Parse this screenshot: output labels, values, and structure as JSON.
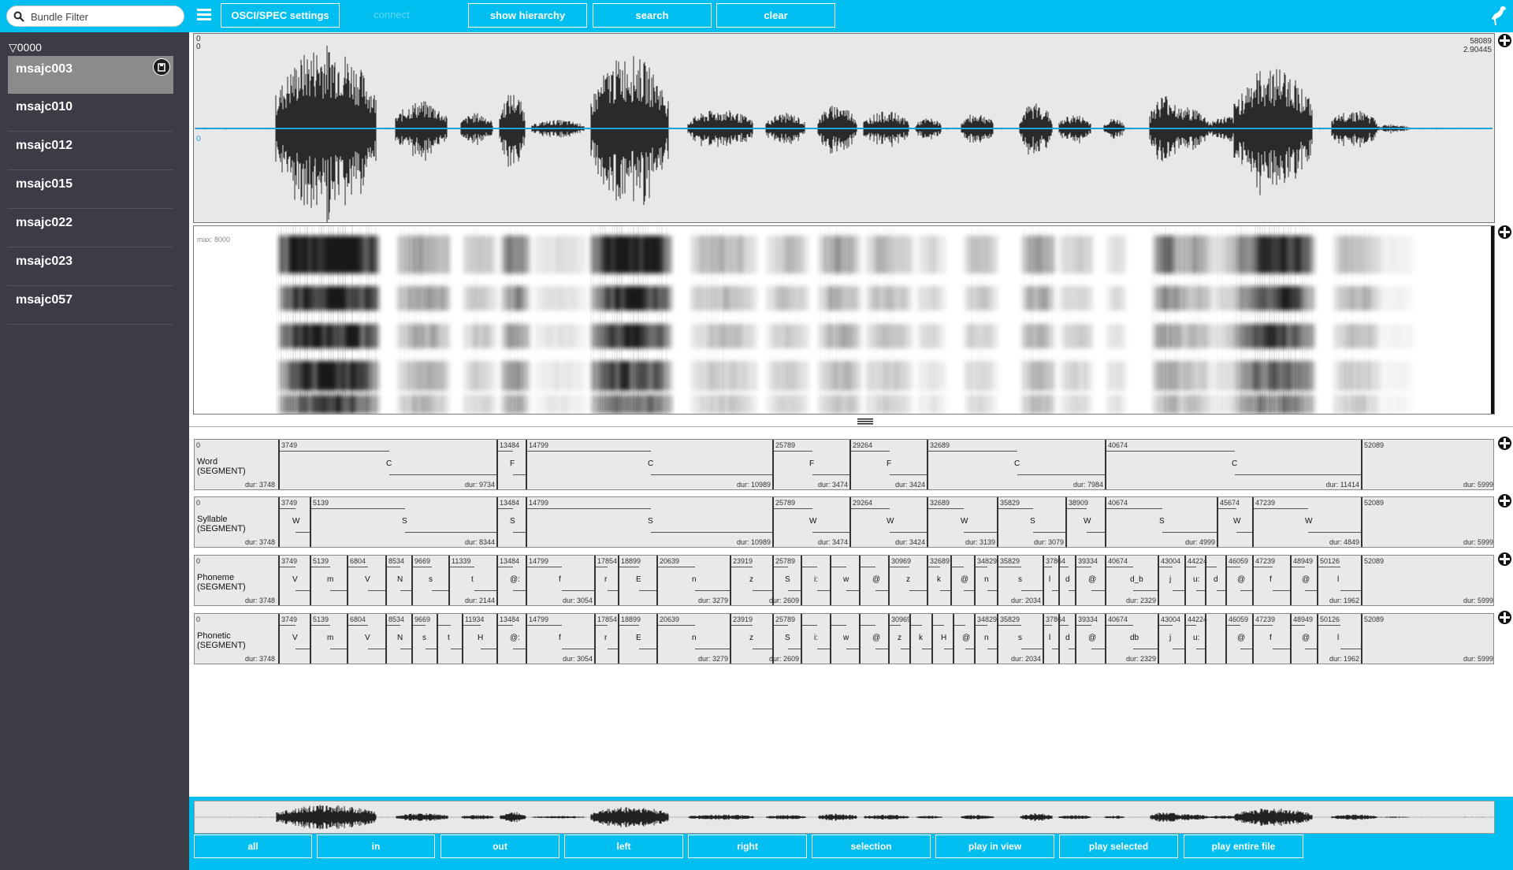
{
  "filter": {
    "placeholder": "Bundle Filter"
  },
  "session": {
    "label": "▽0000"
  },
  "bundles": [
    "msajc003",
    "msajc010",
    "msajc012",
    "msajc015",
    "msajc022",
    "msajc023",
    "msajc057"
  ],
  "toolbar": {
    "osci_settings": "OSCI/SPEC settings",
    "connect": "connect",
    "show_hierarchy": "show hierarchy",
    "search": "search",
    "clear": "clear"
  },
  "osci": {
    "start_top": "0",
    "start_bottom": "0",
    "zero_marker": "0",
    "end_samples": "58089",
    "end_seconds": "2.90445"
  },
  "spec": {
    "max_label": "max: 8000"
  },
  "colors": {
    "accent": "#00bff0",
    "sidebar": "#3b3c46",
    "waveform": "#2a2a2a",
    "zero_line": "#1fa3e0"
  },
  "icons": {
    "menu": "hamburger-icon",
    "filter": "search-icon",
    "logo": "emu-bird-icon",
    "save": "save-disk-icon",
    "resize": "resize-handle-icon"
  },
  "tiers": [
    {
      "name": "Word",
      "type": "(SEGMENT)",
      "start0": "0",
      "dur0": "dur: 3748",
      "segs": [
        {
          "s": "3749",
          "l": "C",
          "d": "dur: 9734"
        },
        {
          "s": "13484",
          "l": "F",
          "d": ""
        },
        {
          "s": "14799",
          "l": "C",
          "d": "dur: 10989"
        },
        {
          "s": "25789",
          "l": "F",
          "d": "dur: 3474"
        },
        {
          "s": "29264",
          "l": "F",
          "d": "dur: 3424"
        },
        {
          "s": "32689",
          "l": "C",
          "d": "dur: 7984"
        },
        {
          "s": "40674",
          "l": "C",
          "d": "dur: 11414"
        },
        {
          "s": "52089",
          "l": "",
          "d": "dur: 5999"
        }
      ]
    },
    {
      "name": "Syllable",
      "type": "(SEGMENT)",
      "start0": "0",
      "dur0": "dur: 3748",
      "segs": [
        {
          "s": "3749",
          "l": "W",
          "d": ""
        },
        {
          "s": "5139",
          "l": "S",
          "d": "dur: 8344"
        },
        {
          "s": "13484",
          "l": "S",
          "d": ""
        },
        {
          "s": "14799",
          "l": "S",
          "d": "dur: 10989"
        },
        {
          "s": "25789",
          "l": "W",
          "d": "dur: 3474"
        },
        {
          "s": "29264",
          "l": "W",
          "d": "dur: 3424"
        },
        {
          "s": "32689",
          "l": "W",
          "d": "dur: 3139"
        },
        {
          "s": "35829",
          "l": "S",
          "d": "dur: 3079"
        },
        {
          "s": "38909",
          "l": "W",
          "d": ""
        },
        {
          "s": "40674",
          "l": "S",
          "d": "dur: 4999"
        },
        {
          "s": "45674",
          "l": "W",
          "d": ""
        },
        {
          "s": "47239",
          "l": "W",
          "d": "dur: 4849"
        },
        {
          "s": "52089",
          "l": "",
          "d": "dur: 5999"
        }
      ]
    },
    {
      "name": "Phoneme",
      "type": "(SEGMENT)",
      "start0": "0",
      "dur0": "dur: 3748",
      "segs": [
        {
          "s": "3749",
          "l": "V",
          "d": ""
        },
        {
          "s": "5139",
          "l": "m",
          "d": ""
        },
        {
          "s": "6804",
          "l": "V",
          "d": ""
        },
        {
          "s": "8534",
          "l": "N",
          "d": ""
        },
        {
          "s": "9669",
          "l": "s",
          "d": ""
        },
        {
          "s": "11339",
          "l": "t",
          "d": "dur: 2144"
        },
        {
          "s": "13484",
          "l": "@:",
          "d": ""
        },
        {
          "s": "14799",
          "l": "f",
          "d": "dur: 3054"
        },
        {
          "s": "17854",
          "l": "r",
          "d": ""
        },
        {
          "s": "18899",
          "l": "E",
          "d": ""
        },
        {
          "s": "20639",
          "l": "n",
          "d": "dur: 3279"
        },
        {
          "s": "23919",
          "l": "z",
          "d": ""
        },
        {
          "s": "25789",
          "l": "S",
          "d": "dur: 2609"
        },
        {
          "s": "",
          "l": "i:",
          "d": ""
        },
        {
          "s": "",
          "l": "w",
          "d": ""
        },
        {
          "s": "",
          "l": "@",
          "d": ""
        },
        {
          "s": "30969",
          "l": "z",
          "d": ""
        },
        {
          "s": "32689",
          "l": "k",
          "d": ""
        },
        {
          "s": "",
          "l": "@",
          "d": ""
        },
        {
          "s": "34829",
          "l": "n",
          "d": ""
        },
        {
          "s": "35829",
          "l": "s",
          "d": "dur: 2034"
        },
        {
          "s": "37864",
          "l": "l",
          "d": ""
        },
        {
          "s": "",
          "l": "d",
          "d": ""
        },
        {
          "s": "39334",
          "l": "@",
          "d": ""
        },
        {
          "s": "40674",
          "l": "d_b",
          "d": "dur: 2329"
        },
        {
          "s": "43004",
          "l": "j",
          "d": ""
        },
        {
          "s": "44224",
          "l": "u:",
          "d": ""
        },
        {
          "s": "",
          "l": "d",
          "d": ""
        },
        {
          "s": "46059",
          "l": "@",
          "d": ""
        },
        {
          "s": "47239",
          "l": "f",
          "d": ""
        },
        {
          "s": "48949",
          "l": "@",
          "d": ""
        },
        {
          "s": "50126",
          "l": "l",
          "d": "dur: 1962"
        },
        {
          "s": "52089",
          "l": "",
          "d": "dur: 5999"
        }
      ]
    },
    {
      "name": "Phonetic",
      "type": "(SEGMENT)",
      "start0": "0",
      "dur0": "dur: 3748",
      "segs": [
        {
          "s": "3749",
          "l": "V",
          "d": ""
        },
        {
          "s": "5139",
          "l": "m",
          "d": ""
        },
        {
          "s": "6804",
          "l": "V",
          "d": ""
        },
        {
          "s": "8534",
          "l": "N",
          "d": ""
        },
        {
          "s": "9669",
          "l": "s",
          "d": ""
        },
        {
          "s": "",
          "l": "t",
          "d": ""
        },
        {
          "s": "11934",
          "l": "H",
          "d": ""
        },
        {
          "s": "13484",
          "l": "@:",
          "d": ""
        },
        {
          "s": "14799",
          "l": "f",
          "d": "dur: 3054"
        },
        {
          "s": "17854",
          "l": "r",
          "d": ""
        },
        {
          "s": "18899",
          "l": "E",
          "d": ""
        },
        {
          "s": "20639",
          "l": "n",
          "d": "dur: 3279"
        },
        {
          "s": "23919",
          "l": "z",
          "d": ""
        },
        {
          "s": "25789",
          "l": "S",
          "d": "dur: 2609"
        },
        {
          "s": "",
          "l": "i:",
          "d": ""
        },
        {
          "s": "",
          "l": "w",
          "d": ""
        },
        {
          "s": "",
          "l": "@",
          "d": ""
        },
        {
          "s": "30969",
          "l": "z",
          "d": ""
        },
        {
          "s": "",
          "l": "k",
          "d": ""
        },
        {
          "s": "",
          "l": "H",
          "d": ""
        },
        {
          "s": "",
          "l": "@",
          "d": ""
        },
        {
          "s": "34829",
          "l": "n",
          "d": ""
        },
        {
          "s": "35829",
          "l": "s",
          "d": "dur: 2034"
        },
        {
          "s": "37864",
          "l": "l",
          "d": ""
        },
        {
          "s": "",
          "l": "d",
          "d": ""
        },
        {
          "s": "39334",
          "l": "@",
          "d": ""
        },
        {
          "s": "40674",
          "l": "db",
          "d": "dur: 2329"
        },
        {
          "s": "43004",
          "l": "j",
          "d": ""
        },
        {
          "s": "44224",
          "l": "u:",
          "d": ""
        },
        {
          "s": "",
          "l": "",
          "d": ""
        },
        {
          "s": "46059",
          "l": "@",
          "d": ""
        },
        {
          "s": "47239",
          "l": "f",
          "d": ""
        },
        {
          "s": "48949",
          "l": "@",
          "d": ""
        },
        {
          "s": "50126",
          "l": "l",
          "d": "dur: 1962"
        },
        {
          "s": "52089",
          "l": "",
          "d": "dur: 5999"
        }
      ]
    }
  ],
  "bottom": {
    "all": "all",
    "in": "in",
    "out": "out",
    "left": "left",
    "right": "right",
    "selection": "selection",
    "play_in_view": "play in view",
    "play_selected": "play selected",
    "play_entire_file": "play entire file"
  }
}
